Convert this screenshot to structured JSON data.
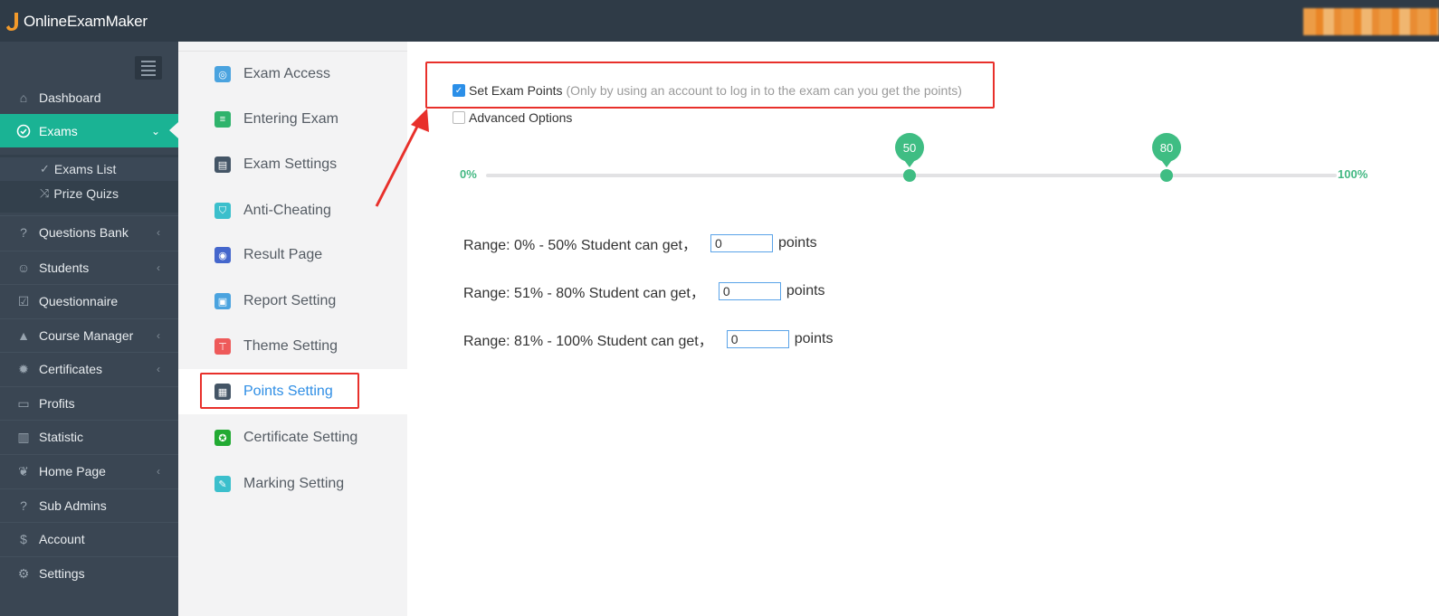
{
  "app": {
    "logo_text": "OnlineExamMaker"
  },
  "sidebar": {
    "items": [
      {
        "label": "Dashboard",
        "icon": "home-icon"
      },
      {
        "label": "Exams",
        "icon": "check-circle-icon",
        "active": true
      },
      {
        "label": "Questions Bank",
        "icon": "question-circle-icon"
      },
      {
        "label": "Students",
        "icon": "users-icon"
      },
      {
        "label": "Questionnaire",
        "icon": "check-square-icon"
      },
      {
        "label": "Course Manager",
        "icon": "graduation-cap-icon"
      },
      {
        "label": "Certificates",
        "icon": "certificate-icon"
      },
      {
        "label": "Profits",
        "icon": "credit-card-icon"
      },
      {
        "label": "Statistic",
        "icon": "bar-chart-icon"
      },
      {
        "label": "Home Page",
        "icon": "leaf-icon"
      },
      {
        "label": "Sub Admins",
        "icon": "question-circle-icon"
      },
      {
        "label": "Account",
        "icon": "dollar-icon"
      },
      {
        "label": "Settings",
        "icon": "gear-icon"
      }
    ],
    "sub_items": [
      {
        "label": "Exams List",
        "icon": "check-circle-icon"
      },
      {
        "label": "Prize Quizs",
        "icon": "shuffle-icon"
      }
    ]
  },
  "settings_menu": {
    "items": [
      {
        "label": "Exam Access",
        "color": "#4aa3df"
      },
      {
        "label": "Entering Exam",
        "color": "#2fb36c"
      },
      {
        "label": "Exam Settings",
        "color": "#445566"
      },
      {
        "label": "Anti-Cheating",
        "color": "#3bbfcc"
      },
      {
        "label": "Result Page",
        "color": "#4466cc"
      },
      {
        "label": "Report Setting",
        "color": "#4aa3df"
      },
      {
        "label": "Theme Setting",
        "color": "#ee5a5a"
      },
      {
        "label": "Points Setting",
        "color": "#445566",
        "active": true
      },
      {
        "label": "Certificate Setting",
        "color": "#22aa33"
      },
      {
        "label": "Marking Setting",
        "color": "#3bbfcc"
      }
    ]
  },
  "points": {
    "set_exam_points_label": "Set Exam Points",
    "set_exam_points_checked": true,
    "set_exam_points_hint": "(Only by using an account to log in to the exam can you get the points)",
    "advanced_options_label": "Advanced Options",
    "advanced_options_checked": false,
    "slider": {
      "min_label": "0%",
      "max_label": "100%",
      "handle_1": "50",
      "handle_2": "80"
    },
    "ranges": [
      {
        "label": "Range: 0% - 50% Student can get，",
        "value": "0",
        "unit": "points"
      },
      {
        "label": "Range: 51% - 80% Student can get，",
        "value": "0",
        "unit": "points"
      },
      {
        "label": "Range: 81% - 100% Student can get，",
        "value": "0",
        "unit": "points"
      }
    ]
  }
}
